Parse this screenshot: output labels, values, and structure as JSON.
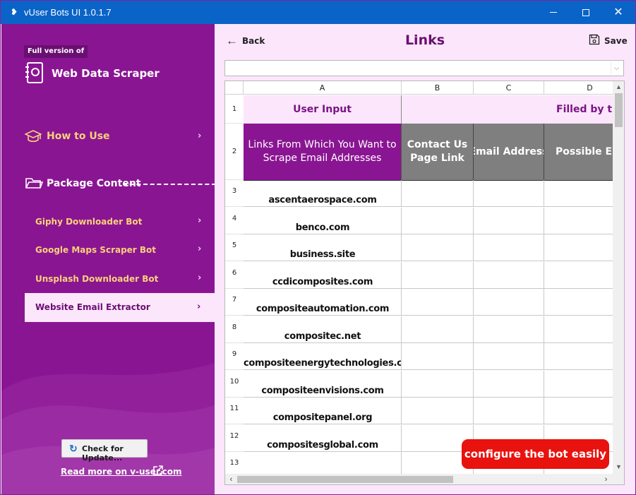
{
  "window": {
    "title": "vUser Bots UI 1.0.1.7",
    "minimize": "",
    "maximize": "",
    "close": "✕"
  },
  "sidebar": {
    "edition": "Full version of",
    "product": "Web Data Scraper",
    "how_to_use": "How to Use",
    "package_content": "Package Content",
    "items": [
      {
        "label": "Giphy Downloader Bot"
      },
      {
        "label": "Google Maps Scraper Bot"
      },
      {
        "label": "Unsplash Downloader Bot"
      },
      {
        "label": "Website Email Extractor",
        "selected": true
      }
    ],
    "update_button": "Check for Update...",
    "read_more": "Read more on v-user.com",
    "accent_color": "#8a1592",
    "highlight_color": "#f8d17a"
  },
  "main": {
    "back_label": "Back",
    "title": "Links",
    "save_label": "Save",
    "dropdown_value": ""
  },
  "grid": {
    "columns": [
      "A",
      "B",
      "C",
      "D"
    ],
    "row1": {
      "a": "User Input",
      "b": "Filled by the"
    },
    "row2": {
      "a": "Links From Which You Want to Scrape Email Addresses",
      "b": "Contact Us Page Link",
      "c": "Email Address",
      "d": "Possible Em Address"
    },
    "rows": [
      {
        "num": "3",
        "link": "ascentaerospace.com"
      },
      {
        "num": "4",
        "link": "benco.com"
      },
      {
        "num": "5",
        "link": "business.site"
      },
      {
        "num": "6",
        "link": "ccdicomposites.com"
      },
      {
        "num": "7",
        "link": "compositeautomation.com"
      },
      {
        "num": "8",
        "link": "compositec.net"
      },
      {
        "num": "9",
        "link": "compositeenergytechnologies.com"
      },
      {
        "num": "10",
        "link": "compositeenvisions.com"
      },
      {
        "num": "11",
        "link": "compositepanel.org"
      },
      {
        "num": "12",
        "link": "compositesglobal.com"
      },
      {
        "num": "13",
        "link": ""
      }
    ],
    "header_fill_color": "#7f7f7f"
  },
  "promo": {
    "text": "configure the bot easily",
    "color": "#e8120e"
  }
}
